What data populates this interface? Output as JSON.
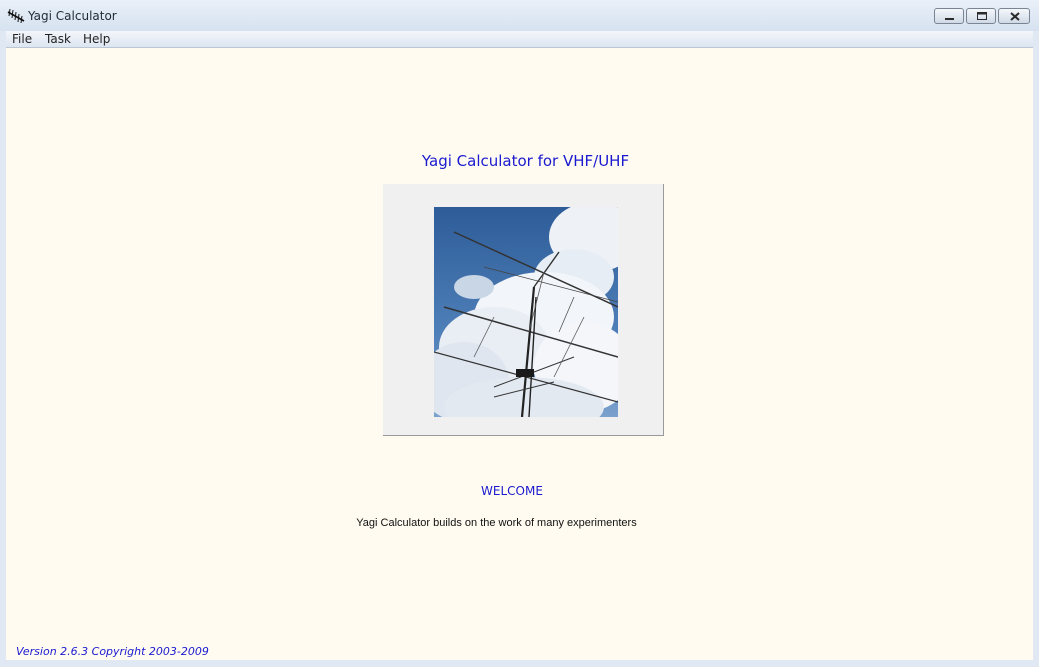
{
  "window": {
    "title": "Yagi Calculator",
    "icon": "yagi-antenna-icon",
    "controls": [
      "minimize-icon",
      "maximize-icon",
      "close-icon"
    ]
  },
  "menu": {
    "file": "File",
    "task": "Task",
    "help": "Help"
  },
  "main": {
    "heading": "Yagi Calculator  for VHF/UHF",
    "image": "yagi-antenna-photo",
    "welcome": "WELCOME",
    "tagline": "Yagi Calculator  builds on the work of many experimenters",
    "version": "Version 2.6.3 Copyright 2003-2009"
  },
  "colors": {
    "background": "#fffbf0",
    "text_accent": "#1a1ad0",
    "image_frame": "#f0f0f0"
  }
}
